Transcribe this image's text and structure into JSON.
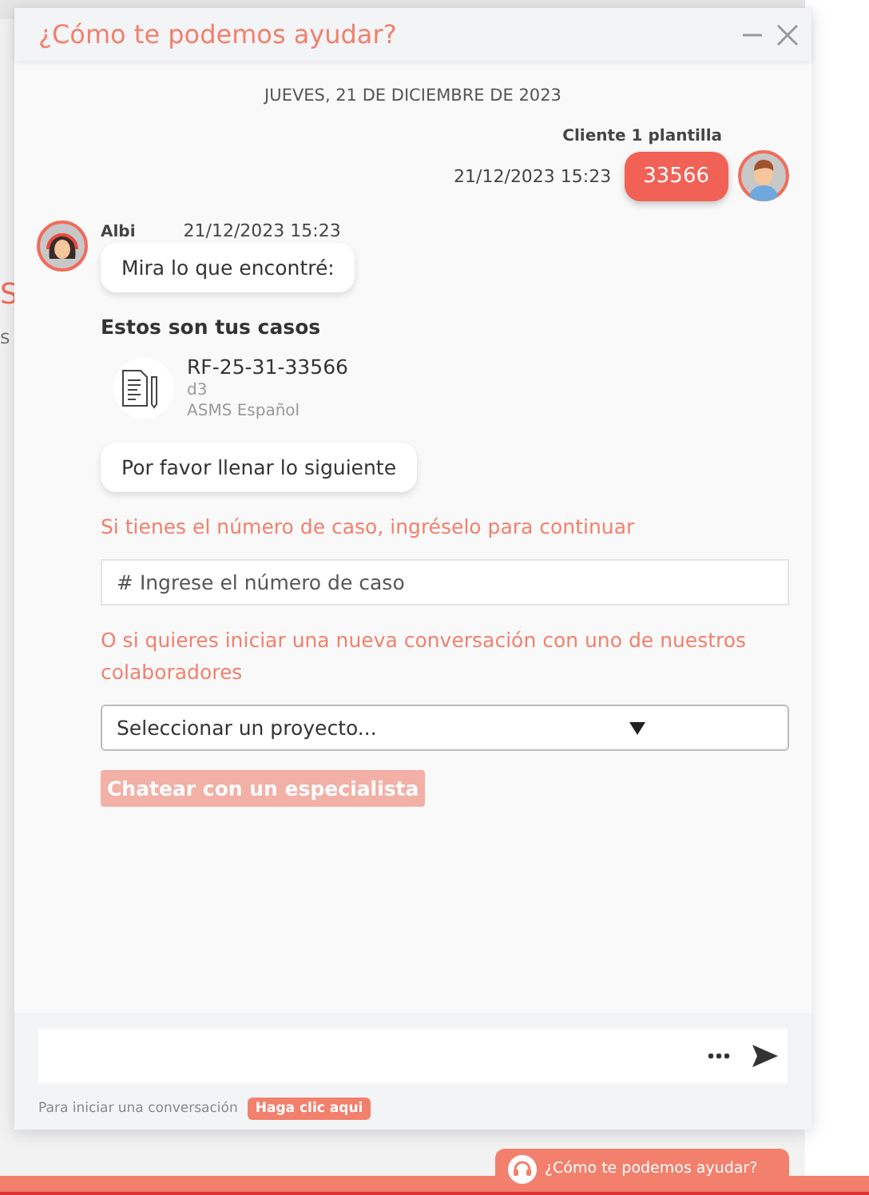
{
  "background_page": {
    "fragments": [
      "S",
      "s"
    ]
  },
  "chat_window": {
    "title": "¿Cómo te podemos ayudar?",
    "date_divider": "JUEVES, 21 DE DICIEMBRE DE 2023",
    "user_message": {
      "sender": "Cliente 1 plantilla",
      "time": "21/12/2023 15:23",
      "text": "33566"
    },
    "bot": {
      "sender": "Albi",
      "time": "21/12/2023 15:23",
      "bubble_1": "Mira lo que encontré:",
      "cases_heading": "Estos son tus casos",
      "cases": [
        {
          "id": "RF-25-31-33566",
          "subtitle": "d3",
          "project": "ASMS Español"
        }
      ],
      "bubble_2": "Por favor llenar lo siguiente",
      "prompt_case": "Si tienes el número de caso, ingréselo para continuar",
      "case_field": {
        "placeholder": "# Ingrese el número de caso"
      },
      "prompt_new": "O si quieres iniciar una nueva conversación con uno de nuestros colaboradores",
      "project_select": {
        "value": "Seleccionar un proyecto..."
      },
      "chat_button": {
        "label": "Chatear con un especialista",
        "disabled": true
      }
    },
    "footer": {
      "hint": "Para iniciar una conversación",
      "link": "Haga clic aqui"
    }
  },
  "launcher": {
    "label": "¿Cómo te podemos ayudar?"
  }
}
